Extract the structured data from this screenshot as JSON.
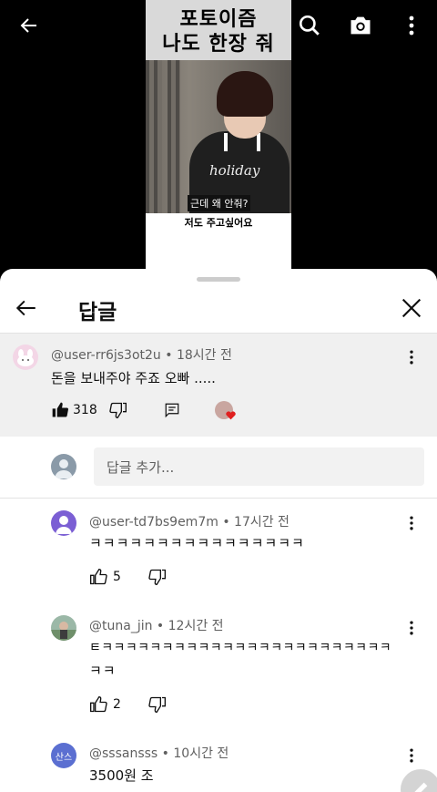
{
  "video": {
    "title_line1": "포토이즘",
    "title_line2": "나도 한장 줘",
    "shirt_text": "holiday",
    "subtitle": "근데 왜 안줘?",
    "caption": "저도 주고싶어요"
  },
  "top_bar": {
    "back_icon": "arrow-left-icon",
    "search_icon": "search-icon",
    "camera_icon": "camera-icon",
    "more_icon": "more-vertical-icon"
  },
  "sheet": {
    "title": "답글"
  },
  "parent_comment": {
    "author": "@user-rr6js3ot2u",
    "time": "18시간 전",
    "text": "돈을 보내주야 주죠 오빠 .....",
    "likes": "318"
  },
  "reply_input": {
    "placeholder": "답글 추가..."
  },
  "replies": [
    {
      "author": "@user-td7bs9em7m",
      "time": "17시간 전",
      "text_line1": "ㅋㅋㅋㅋㅋㅋㅋㅋㅋㅋㅋㅋㅋㅋㅋㅋ",
      "text_line2": "",
      "likes": "5"
    },
    {
      "author": "@tuna_jin",
      "time": "12시간 전",
      "text_line1": "ㅌㅋㅋㅋㅋㅋㅋㅋㅋㅋㅋㅋㅋㅋㅋㅋㅋㅋㅋㅋㅋㅋㅋㅋㅋ",
      "text_line2": "ㅋㅋ",
      "likes": "2"
    },
    {
      "author": "@sssansss",
      "avatar_text": "산스",
      "time": "10시간 전",
      "text_line1": "3500원 조",
      "text_line2": "",
      "likes": ""
    }
  ],
  "colors": {
    "sheet_bg": "#ffffff",
    "parent_bg": "#f0f0f0",
    "heart": "#e02020",
    "avatar_purple": "#7b5fd4",
    "avatar_blue": "#5b6fd1"
  }
}
